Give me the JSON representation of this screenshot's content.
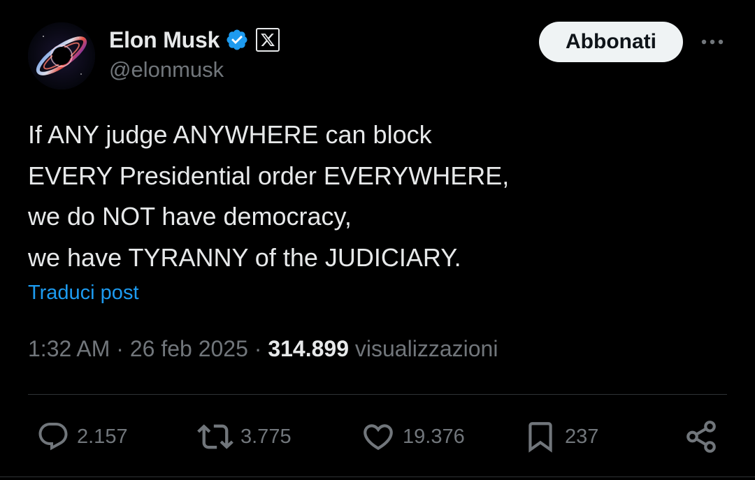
{
  "author": {
    "display_name": "Elon Musk",
    "handle": "@elonmusk",
    "avatar_icon": "black-hole-avatar",
    "verified_color": "#1d9bf0",
    "affiliation_icon": "x-logo-icon"
  },
  "header": {
    "subscribe_label": "Abbonati",
    "more_icon": "more-dots-icon"
  },
  "post": {
    "lines": [
      "If ANY judge ANYWHERE can block",
      "EVERY Presidential order EVERYWHERE,",
      "we do NOT have democracy,",
      "we have TYRANNY of the JUDICIARY."
    ],
    "translate_label": "Traduci post"
  },
  "meta": {
    "time": "1:32 AM",
    "separator": "·",
    "date": "26 feb 2025",
    "views_count": "314.899",
    "views_label": "visualizzazioni"
  },
  "actions": {
    "replies": "2.157",
    "reposts": "3.775",
    "likes": "19.376",
    "bookmarks": "237"
  },
  "colors": {
    "background": "#000000",
    "text": "#e7e9ea",
    "secondary": "#71767b",
    "link": "#1d9bf0",
    "button_bg": "#eff3f4",
    "divider": "#2f3336"
  }
}
